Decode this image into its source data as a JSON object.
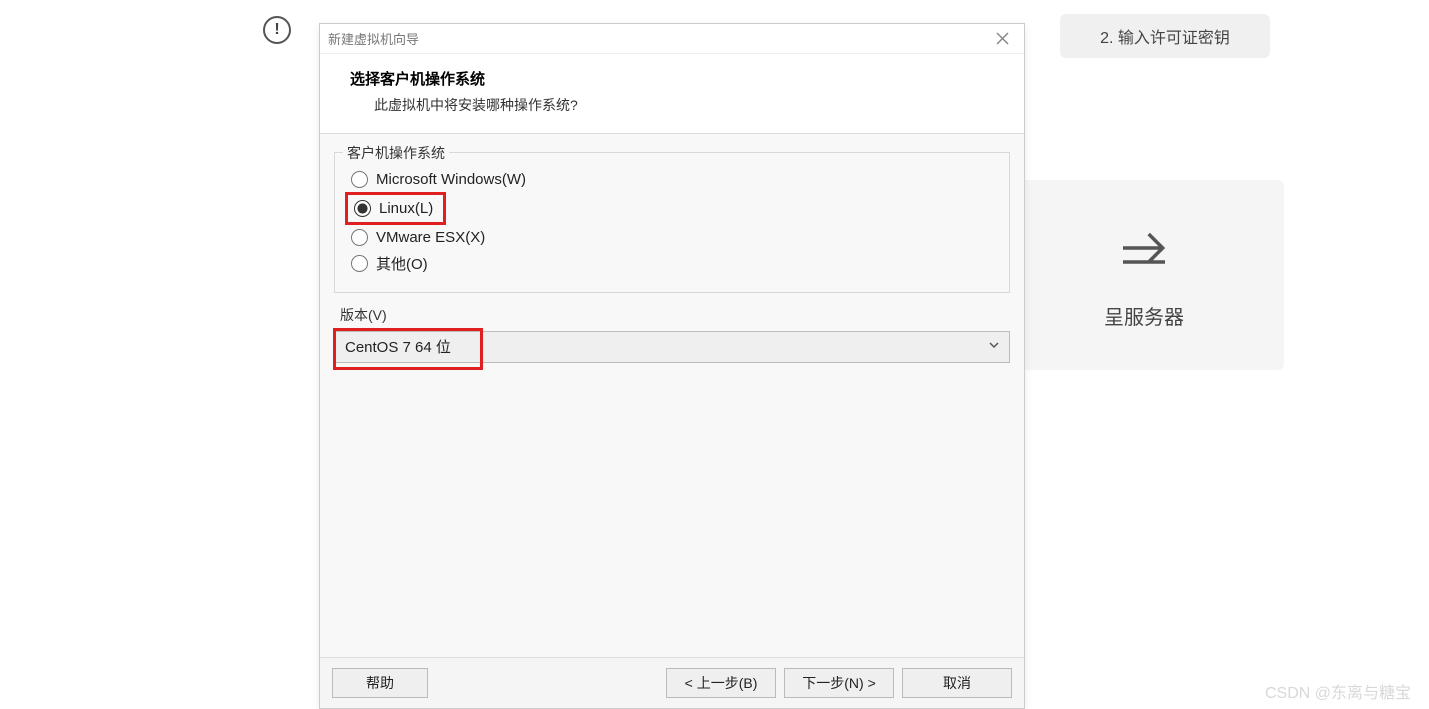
{
  "background": {
    "button2": "2. 输入许可证密钥",
    "card_label": "呈服务器"
  },
  "dialog": {
    "title": "新建虚拟机向导",
    "header": {
      "title": "选择客户机操作系统",
      "subtitle": "此虚拟机中将安装哪种操作系统?"
    },
    "os_group": {
      "legend": "客户机操作系统",
      "options": [
        {
          "label": "Microsoft Windows(W)",
          "checked": false
        },
        {
          "label": "Linux(L)",
          "checked": true
        },
        {
          "label": "VMware ESX(X)",
          "checked": false
        },
        {
          "label": "其他(O)",
          "checked": false
        }
      ]
    },
    "version": {
      "label": "版本(V)",
      "selected": "CentOS 7 64 位"
    },
    "buttons": {
      "help": "帮助",
      "back": "< 上一步(B)",
      "next": "下一步(N) >",
      "cancel": "取消"
    }
  },
  "watermark": "CSDN @东离与糖宝"
}
